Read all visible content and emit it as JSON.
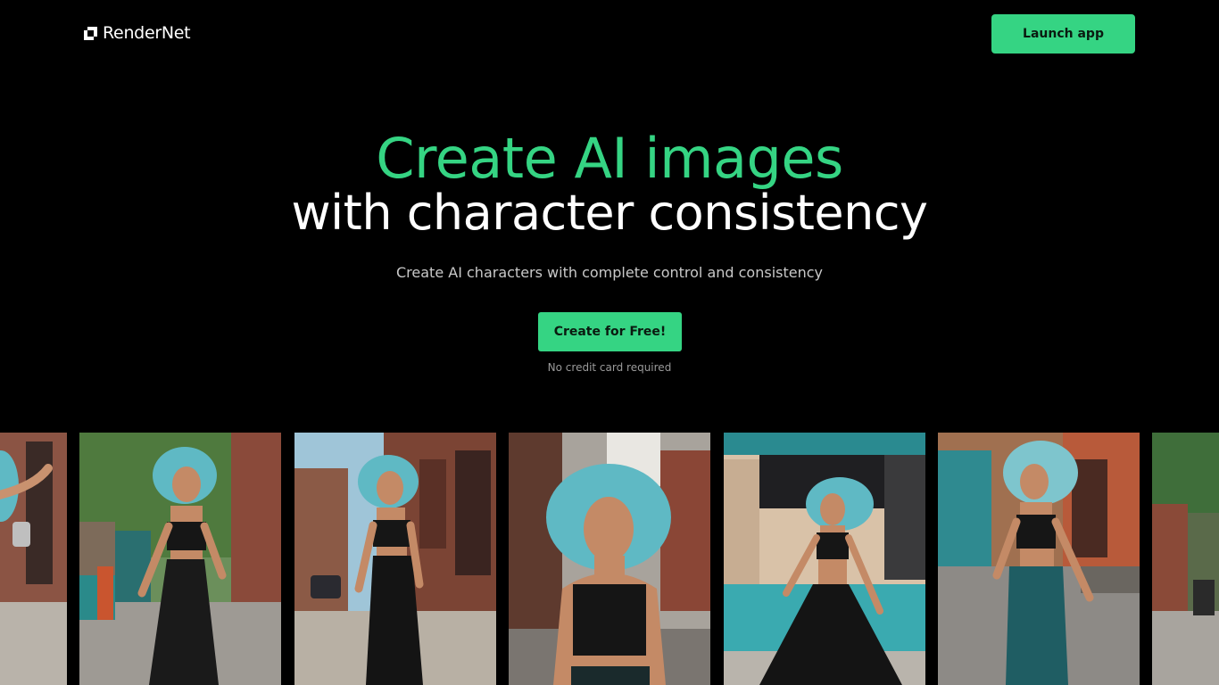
{
  "header": {
    "logo_text": "RenderNet",
    "launch_label": "Launch app"
  },
  "hero": {
    "title_line1": "Create AI images",
    "title_line2": "with character consistency",
    "subtitle": "Create AI characters with complete control and consistency",
    "cta_label": "Create for Free!",
    "cta_note": "No credit card required"
  },
  "colors": {
    "accent": "#35d483",
    "background": "#000000",
    "hair": "#5fb9c4"
  },
  "gallery": {
    "images": [
      "dancing-woman-teal-hair-partial",
      "dancing-woman-teal-hair-street-1",
      "walking-woman-teal-hair-street",
      "woman-teal-hair-closeup",
      "dancing-woman-teal-hair-teal-wall",
      "dancing-woman-teal-hair-street-2",
      "street-scene-partial"
    ]
  }
}
